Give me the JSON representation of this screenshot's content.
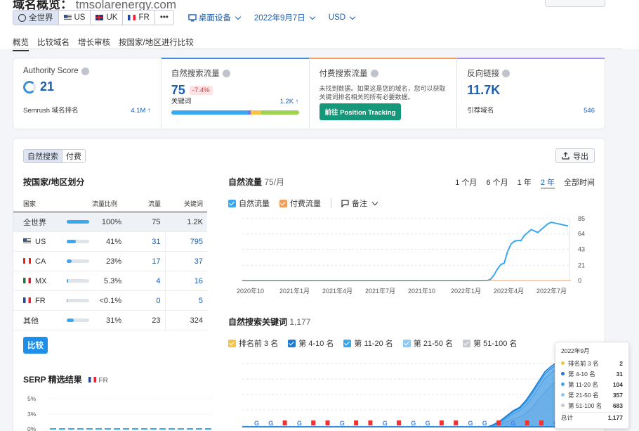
{
  "header": {
    "title": "域名概览：",
    "domain": "tmsolarenergy.com",
    "db_segments": [
      {
        "label": "全世界",
        "icon": "globe-icon",
        "active": true
      },
      {
        "label": "US",
        "icon": "flag-us-icon"
      },
      {
        "label": "UK",
        "icon": "flag-uk-icon"
      },
      {
        "label": "FR",
        "icon": "flag-fr-icon"
      },
      {
        "label": "•••",
        "icon": "more-icon"
      }
    ],
    "device": "桌面设备",
    "date": "2022年9月7日",
    "currency": "USD"
  },
  "tabs": [
    "概览",
    "比较域名",
    "增长审核",
    "按国家/地区进行比较"
  ],
  "cards": {
    "authority": {
      "title": "Authority Score",
      "value": "21",
      "sub_label": "Semrush 域名排名",
      "sub_value": "4.1M ↑"
    },
    "organic": {
      "title": "自然搜索流量",
      "value": "75",
      "badge": "-7.4%",
      "kw_label": "关键词",
      "kw_value": "1.2K ↑"
    },
    "paid": {
      "title": "付费搜索流量",
      "text": "未找到数据。如果这是您的域名，您可以获取关键词排名相关的所有必要数据。",
      "button": "前往 Position Tracking"
    },
    "backlinks": {
      "title": "反向链接",
      "value": "11.7K",
      "sub_label": "引荐域名",
      "sub_value": "546"
    }
  },
  "toggle": {
    "organic": "自然搜索",
    "paid": "付费"
  },
  "export": "导出",
  "country_section": {
    "title": "按国家/地区划分",
    "headers": [
      "国家",
      "流量比例",
      "流量",
      "关键词"
    ],
    "rows": [
      {
        "country": "全世界",
        "flag": "",
        "share": "100%",
        "share_val": 100,
        "traffic": "75",
        "keywords": "1.2K",
        "link": false
      },
      {
        "country": "US",
        "flag": "flag-us",
        "share": "41%",
        "share_val": 41,
        "traffic": "31",
        "keywords": "795",
        "link": true
      },
      {
        "country": "CA",
        "flag": "flag-ca",
        "share": "23%",
        "share_val": 23,
        "traffic": "17",
        "keywords": "37",
        "link": true
      },
      {
        "country": "MX",
        "flag": "flag-mx",
        "share": "5.3%",
        "share_val": 5.3,
        "traffic": "4",
        "keywords": "16",
        "link": true
      },
      {
        "country": "FR",
        "flag": "flag-fr",
        "share": "<0.1%",
        "share_val": 0.1,
        "traffic": "0",
        "keywords": "5",
        "link": true
      },
      {
        "country": "其他",
        "flag": "",
        "share": "31%",
        "share_val": 31,
        "traffic": "23",
        "keywords": "324",
        "link": false
      }
    ],
    "compare": "比较"
  },
  "serp": {
    "title": "SERP 精选结果",
    "db": "FR",
    "yticks": [
      "5%",
      "3%",
      "0%"
    ]
  },
  "traffic_chart": {
    "title": "自然流量",
    "subtitle": "75/月",
    "periods": [
      "1 个月",
      "6 个月",
      "1 年",
      "2 年",
      "全部时间"
    ],
    "active_period": "2 年",
    "legend": [
      {
        "name": "自然流量",
        "color": "#38a8f0"
      },
      {
        "name": "付费流量",
        "color": "#f29e5b"
      }
    ],
    "notes": "备注"
  },
  "keywords_chart": {
    "title": "自然搜索关键词",
    "count": "1,177",
    "legend": [
      {
        "name": "排名前 3 名",
        "color": "#f5c444"
      },
      {
        "name": "第 4-10 名",
        "color": "#1a7bd6"
      },
      {
        "name": "第 11-20 名",
        "color": "#38a8f0"
      },
      {
        "name": "第 21-50 名",
        "color": "#8ccaf5"
      },
      {
        "name": "第 51-100 名",
        "color": "#c5c9d2"
      }
    ]
  },
  "tooltip": {
    "date": "2022年9月",
    "rows": [
      {
        "name": "排名前 3 名",
        "value": "2",
        "color": "#f5c444"
      },
      {
        "name": "第 4-10 名",
        "value": "31",
        "color": "#1a7bd6"
      },
      {
        "name": "第 11-20 名",
        "value": "104",
        "color": "#38a8f0"
      },
      {
        "name": "第 21-50 名",
        "value": "357",
        "color": "#8ccaf5"
      },
      {
        "name": "第 51-100 名",
        "value": "683",
        "color": "#c5c9d2"
      }
    ],
    "total_label": "总计",
    "total_value": "1,177"
  },
  "chart_data": [
    {
      "type": "line",
      "title": "自然流量",
      "x": [
        "2020年10",
        "2021年1月",
        "2021年4月",
        "2021年7月",
        "2021年10",
        "2022年1月",
        "2022年4月",
        "2022年7月"
      ],
      "yticks": [
        0,
        21,
        43,
        64,
        85
      ],
      "ylim": [
        0,
        85
      ],
      "series": [
        {
          "name": "自然流量",
          "values": [
            0,
            0,
            0,
            0,
            0,
            0,
            0,
            0,
            0,
            0,
            0,
            0,
            0,
            0,
            0,
            0,
            0,
            0,
            0,
            0,
            0,
            0,
            0,
            0,
            0,
            0,
            0,
            0,
            0,
            0,
            0,
            0,
            0,
            0,
            0,
            0,
            0,
            0,
            0,
            0,
            0,
            0,
            0,
            0,
            0,
            0,
            0,
            0,
            0,
            0,
            0,
            0,
            0,
            0,
            0,
            0,
            0,
            0,
            0,
            0,
            0,
            0,
            0,
            0,
            0,
            0,
            0,
            0,
            0,
            0,
            0,
            0,
            0,
            0,
            2,
            8,
            16,
            22,
            24,
            40,
            50,
            54,
            55,
            55,
            62,
            66,
            70,
            68,
            66,
            70,
            74,
            78,
            80,
            79,
            78,
            77,
            76,
            75
          ]
        }
      ],
      "grid": true
    },
    {
      "type": "area",
      "title": "自然搜索关键词",
      "series": [
        {
          "name": "第 51-100 名",
          "values": [
            0,
            0,
            0,
            0,
            0,
            0,
            0,
            0,
            0,
            0,
            0,
            0,
            0,
            0,
            0,
            0,
            0,
            0,
            0,
            0,
            0,
            0,
            0,
            0,
            0,
            0,
            0,
            0,
            0,
            0,
            0,
            0,
            0,
            0,
            0,
            0,
            0,
            0,
            0,
            0,
            2,
            5,
            10,
            14,
            18,
            25,
            36,
            50,
            64,
            76,
            88,
            96
          ]
        },
        {
          "name": "第 21-50 名",
          "values": [
            0,
            0,
            0,
            0,
            0,
            0,
            0,
            0,
            0,
            0,
            0,
            0,
            0,
            0,
            0,
            0,
            0,
            0,
            0,
            0,
            0,
            0,
            0,
            0,
            0,
            0,
            0,
            0,
            0,
            0,
            0,
            0,
            0,
            0,
            0,
            0,
            0,
            0,
            0,
            0,
            3,
            8,
            16,
            24,
            30,
            40,
            55,
            72,
            90,
            100,
            110,
            118
          ]
        },
        {
          "name": "第 11-20 名",
          "values": [
            0,
            0,
            0,
            0,
            0,
            0,
            0,
            0,
            0,
            0,
            0,
            0,
            0,
            0,
            0,
            0,
            0,
            0,
            0,
            0,
            0,
            0,
            0,
            0,
            0,
            0,
            0,
            0,
            0,
            0,
            0,
            0,
            0,
            0,
            0,
            0,
            0,
            0,
            0,
            0,
            4,
            10,
            19,
            28,
            34,
            46,
            62,
            80,
            98,
            108,
            116,
            124
          ]
        },
        {
          "name": "第 4-10 名",
          "values": [
            0,
            0,
            0,
            0,
            0,
            0,
            0,
            0,
            0,
            0,
            0,
            0,
            0,
            0,
            0,
            0,
            0,
            0,
            0,
            0,
            0,
            0,
            0,
            0,
            0,
            0,
            0,
            0,
            0,
            0,
            0,
            0,
            0,
            0,
            0,
            0,
            0,
            0,
            0,
            0,
            5,
            12,
            21,
            30,
            36,
            49,
            66,
            84,
            102,
            112,
            120,
            128
          ]
        }
      ],
      "grid": true
    }
  ]
}
